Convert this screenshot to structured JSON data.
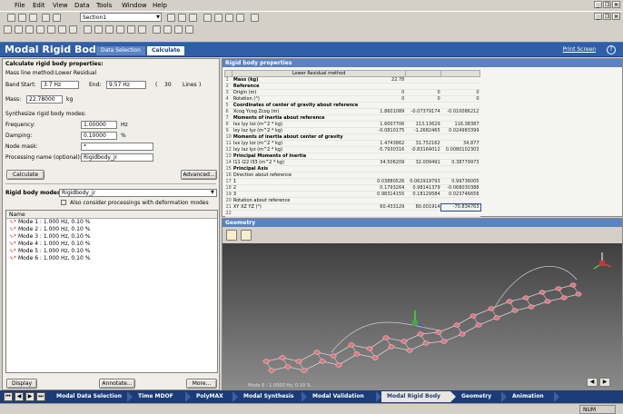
{
  "menu": [
    "File",
    "Edit",
    "View",
    "Data",
    "Tools",
    "Window",
    "Help"
  ],
  "toolbar": {
    "section": "Section1"
  },
  "header": {
    "title": "Modal Rigid Body",
    "crumbs": [
      "Data Selection",
      "Calculate"
    ],
    "print": "Print Screen",
    "help": "?"
  },
  "left": {
    "section_title": "Calculate rigid body properties:",
    "mass_line_label": "Mass line method:",
    "mass_line_value": "Lower Residual",
    "band_label": "Band",
    "start_label": "Start:",
    "start_value": "3.7 Hz",
    "end_label": "End:",
    "end_value": "9.57 Hz",
    "lines_value": "30",
    "lines_label": "Lines",
    "mass_label": "Mass:",
    "mass_value": "22.78000",
    "mass_unit": "kg",
    "synth_title": "Synthesize rigid body modes:",
    "freq_label": "Frequency:",
    "freq_value": "1.00000",
    "freq_unit": "Hz",
    "damp_label": "Damping:",
    "damp_value": "0.10000",
    "damp_unit": "%",
    "nodemask_label": "Node mask:",
    "nodemask_value": "*",
    "procname_label": "Processing name (optional):",
    "procname_value": "Rigidbody_jr",
    "calc_button": "Calculate",
    "advanced_button": "Advanced...",
    "rbm_label": "Rigid body modes:",
    "rbm_value": "Rigidbody_jr",
    "also_consider": "Also consider processings with deformation modes",
    "list_header": "Name",
    "modes": [
      "Mode  1 : 1.000 Hz, 0.10 %",
      "Mode  2 : 1.000 Hz, 0.10 %",
      "Mode  3 : 1.000 Hz, 0.10 %",
      "Mode  4 : 1.000 Hz, 0.10 %",
      "Mode  5 : 1.000 Hz, 0.10 %",
      "Mode  6 : 1.000 Hz, 0.10 %"
    ],
    "display_button": "Display",
    "annotate_button": "Annotate...",
    "more_button": "More..."
  },
  "rbp": {
    "title": "Rigid body properties",
    "column_header": "Lower Residual method",
    "rows": [
      {
        "n": "1",
        "label": "Mass (kg)",
        "bold": true,
        "v": [
          "22.78",
          "",
          ""
        ]
      },
      {
        "n": "2",
        "label": "Reference",
        "bold": true,
        "v": [
          "",
          "",
          ""
        ]
      },
      {
        "n": "3",
        "label": "Origin (m)",
        "bold": false,
        "v": [
          "0",
          "0",
          "0"
        ]
      },
      {
        "n": "4",
        "label": "Rotation (°)",
        "bold": false,
        "v": [
          "0",
          "0",
          "0"
        ]
      },
      {
        "n": "5",
        "label": "Coordinates of center of gravity about reference",
        "bold": true,
        "v": [
          "",
          "",
          ""
        ]
      },
      {
        "n": "6",
        "label": "Xcog Ycog Zcog (m)",
        "bold": false,
        "v": [
          "1.8601089",
          "-0.07379174",
          "-0.010086212"
        ]
      },
      {
        "n": "7",
        "label": "Moments of inertia about reference",
        "bold": true,
        "v": [
          "",
          "",
          ""
        ]
      },
      {
        "n": "8",
        "label": "Ixx Iyy Izz (m^2 * kg)",
        "bold": false,
        "v": [
          "1.6007706",
          "113.13629",
          "116.38387"
        ]
      },
      {
        "n": "9",
        "label": "Ixy Ixz Iyz (m^2 * kg)",
        "bold": false,
        "v": [
          "-0.0810175",
          "-1.2682465",
          "0.024983399"
        ]
      },
      {
        "n": "10",
        "label": "Moments of inertia about center of gravity",
        "bold": true,
        "v": [
          "",
          "",
          ""
        ]
      },
      {
        "n": "11",
        "label": "Ixx Iyy Izz (m^2 * kg)",
        "bold": false,
        "v": [
          "1.4743862",
          "31.752162",
          "34.877"
        ]
      },
      {
        "n": "12",
        "label": "Ixy Ixz Iyz (m^2 * kg)",
        "bold": false,
        "v": [
          "-5.7930316",
          "-0.83164012",
          "0.0080102303"
        ]
      },
      {
        "n": "13",
        "label": "Principal Moments of Inertia",
        "bold": true,
        "v": [
          "",
          "",
          ""
        ]
      },
      {
        "n": "14",
        "label": "I11 I22 I33 (m^2 * kg)",
        "bold": false,
        "v": [
          "34.506209",
          "32.009491",
          "0.38779973"
        ]
      },
      {
        "n": "15",
        "label": "Principal Axis",
        "bold": true,
        "v": [
          "",
          "",
          ""
        ]
      },
      {
        "n": "16",
        "label": "Direction about reference",
        "bold": false,
        "v": [
          "",
          "",
          ""
        ]
      },
      {
        "n": "17",
        "label": "1",
        "bold": false,
        "v": [
          "0.03880526",
          "0.062919793",
          "0.99736005"
        ]
      },
      {
        "n": "18",
        "label": "2",
        "bold": false,
        "v": [
          "0.1793264",
          "0.98141379",
          "-0.068030388"
        ]
      },
      {
        "n": "19",
        "label": "3",
        "bold": false,
        "v": [
          "0.98314155",
          "0.18129584",
          "0.023746656"
        ]
      },
      {
        "n": "20",
        "label": "Rotation about reference",
        "bold": false,
        "v": [
          "",
          "",
          ""
        ]
      },
      {
        "n": "21",
        "label": "XY XZ YZ (°)",
        "bold": false,
        "v": [
          "60.433129",
          "80.001914",
          "-70.834763"
        ]
      },
      {
        "n": "22",
        "label": "",
        "bold": false,
        "v": [
          "",
          "",
          ""
        ]
      }
    ]
  },
  "geometry": {
    "title": "Geometry",
    "status": "Mode  6 : 1.0000 Hz, 0.10 %"
  },
  "flow": [
    "Modal Data Selection",
    "Time MDOF",
    "PolyMAX",
    "Modal Synthesis",
    "Modal Validation",
    "Modal Rigid Body",
    "Geometry",
    "Animation"
  ],
  "statusbar": {
    "num": "NUM"
  },
  "colors": {
    "header": "#2f5fa7",
    "flowbar": "#1b3c78",
    "node": "#e8707a"
  }
}
